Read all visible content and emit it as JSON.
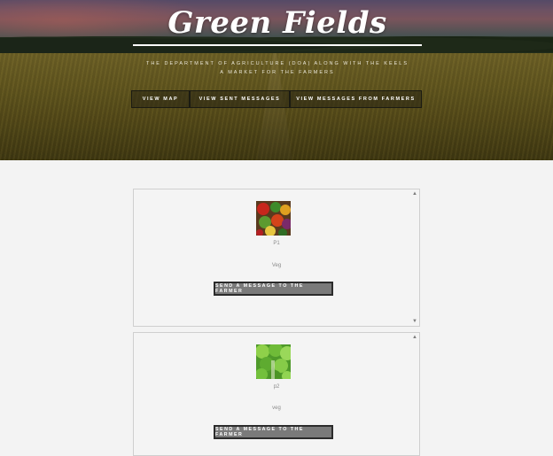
{
  "header": {
    "logo": "Green Fields",
    "tagline_line1": "THE DEPARTMENT OF AGRICULTURE (DOA) ALONG WITH THE KEELS",
    "tagline_line2": "A MARKET FOR THE FARMERS"
  },
  "nav": {
    "items": [
      {
        "label": "VIEW MAP"
      },
      {
        "label": "VIEW SENT MESSAGES"
      },
      {
        "label": "VIEW MESSAGES FROM FARMERS"
      }
    ]
  },
  "listings": [
    {
      "name": "P1",
      "category": "Veg",
      "button": "SEND A MESSAGE TO THE FARMER",
      "image": "vegetables-photo"
    },
    {
      "name": "p2",
      "category": "veg",
      "button": "SEND A MESSAGE TO THE FARMER",
      "image": "lettuce-photo"
    }
  ],
  "icons": {
    "scroll_up": "triangle-up-icon",
    "scroll_down": "triangle-down-icon"
  },
  "colors": {
    "page_bg": "#f3f3f3",
    "button_bg": "#7a7a7a",
    "button_border": "#2b2b2b",
    "logo_text": "#ffffff"
  }
}
